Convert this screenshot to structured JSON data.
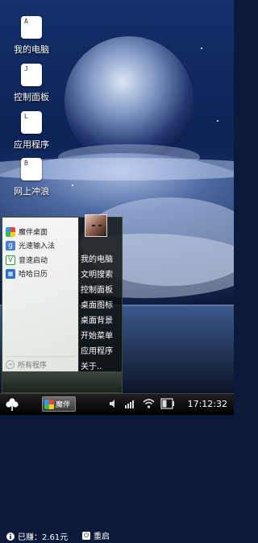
{
  "desktop": {
    "icons": [
      {
        "label": "我的电脑",
        "letter": "A"
      },
      {
        "label": "控制面板",
        "letter": "J"
      },
      {
        "label": "应用程序",
        "letter": "L"
      },
      {
        "label": "网上冲浪",
        "letter": "B"
      }
    ]
  },
  "start_menu": {
    "apps": [
      {
        "label": "魔伴桌面",
        "color": "#e8e8e8",
        "icon": "mobanzhuomian-icon"
      },
      {
        "label": "光速输入法",
        "color": "#4a7fd0",
        "icon": "guangsu-input-icon"
      },
      {
        "label": "音速启动",
        "color": "#2a9a3a",
        "icon": "yinsu-launcher-icon"
      },
      {
        "label": "哈哈日历",
        "color": "#2d6fc9",
        "icon": "calendar-icon"
      }
    ],
    "all_programs": "所有程序",
    "links": [
      "我的电脑",
      "文明搜索",
      "控制面板",
      "桌面图标",
      "桌面背景",
      "开始菜单",
      "应用程序",
      "关于.."
    ],
    "earned": "已赚：2.61元",
    "restart": "重启"
  },
  "taskbar": {
    "task_label": "魔伴",
    "time": "17:12:32"
  }
}
